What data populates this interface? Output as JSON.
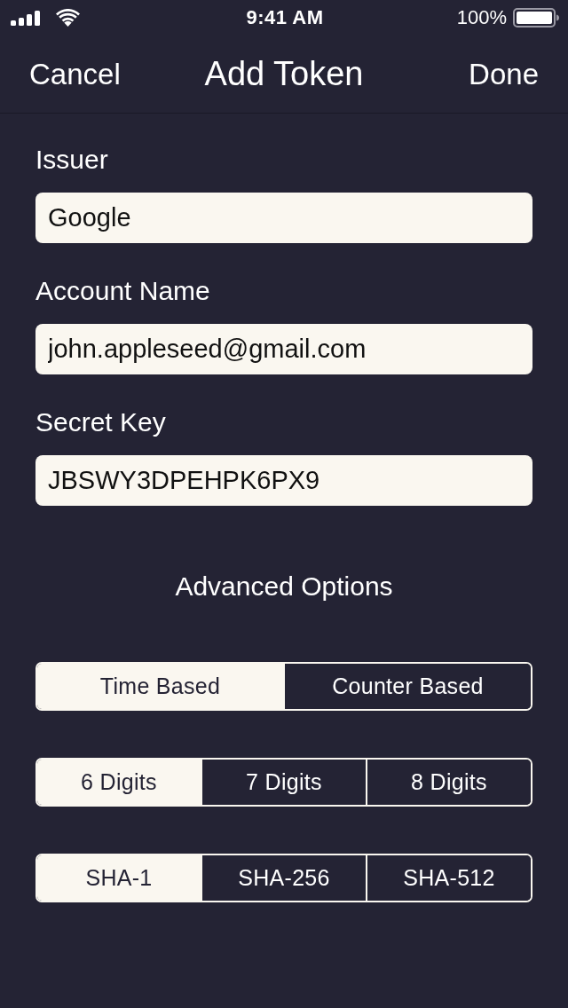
{
  "status_bar": {
    "time": "9:41 AM",
    "battery": "100%"
  },
  "nav_bar": {
    "cancel": "Cancel",
    "title": "Add Token",
    "done": "Done"
  },
  "fields": [
    {
      "label": "Issuer",
      "value": "Google"
    },
    {
      "label": "Account Name",
      "value": "john.appleseed@gmail.com"
    },
    {
      "label": "Secret Key",
      "value": "JBSWY3DPEHPK6PX9"
    }
  ],
  "advanced_options": {
    "title": "Advanced Options",
    "segmented_controls": [
      {
        "segments": [
          {
            "label": "Time Based",
            "selected": true
          },
          {
            "label": "Counter Based",
            "selected": false
          }
        ]
      },
      {
        "segments": [
          {
            "label": "6 Digits",
            "selected": true
          },
          {
            "label": "7 Digits",
            "selected": false
          },
          {
            "label": "8 Digits",
            "selected": false
          }
        ]
      },
      {
        "segments": [
          {
            "label": "SHA-1",
            "selected": true
          },
          {
            "label": "SHA-256",
            "selected": false
          },
          {
            "label": "SHA-512",
            "selected": false
          }
        ]
      }
    ]
  }
}
